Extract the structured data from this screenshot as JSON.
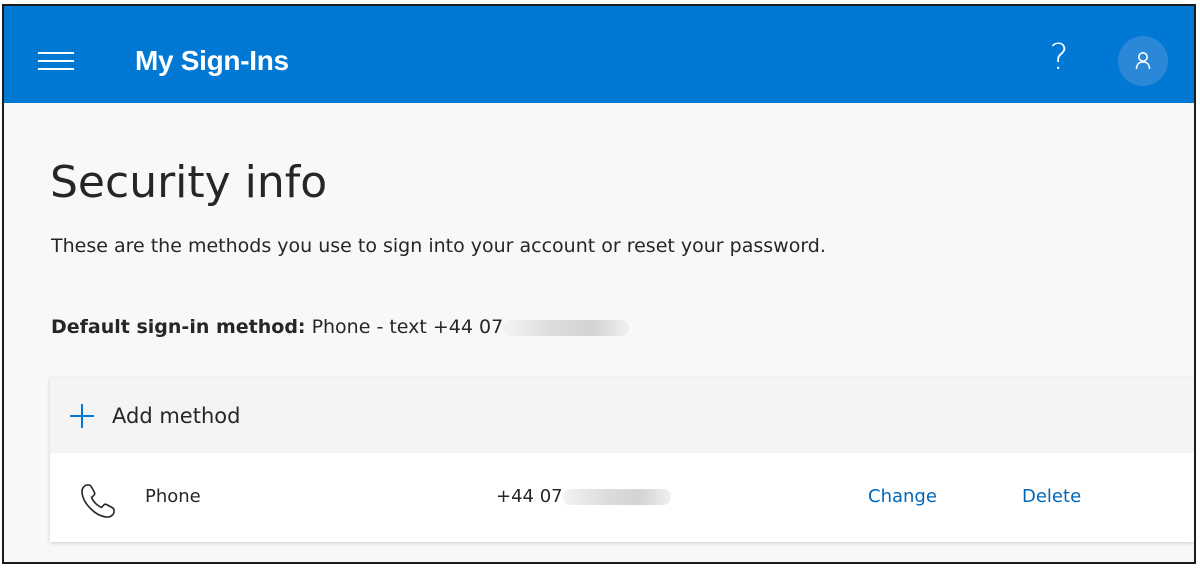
{
  "header": {
    "app_title": "My Sign-Ins",
    "help_glyph": "?",
    "menu_icon": "hamburger-menu-icon",
    "help_icon": "help-icon",
    "avatar_icon": "user-avatar-icon",
    "bar_color": "#0078d4",
    "avatar_color": "#2b88d8"
  },
  "page": {
    "title": "Security info",
    "subtitle": "These are the methods you use to sign into your account or reset your password.",
    "default_method_label": "Default sign-in method:",
    "default_method_value": "Phone - text +44 07"
  },
  "methods": {
    "add_label": "Add method",
    "add_icon": "plus-icon",
    "rows": [
      {
        "icon": "phone-icon",
        "name": "Phone",
        "value": "+44 07",
        "change_label": "Change",
        "delete_label": "Delete"
      }
    ]
  },
  "colors": {
    "link": "#0067b8",
    "accent": "#0078d4"
  }
}
